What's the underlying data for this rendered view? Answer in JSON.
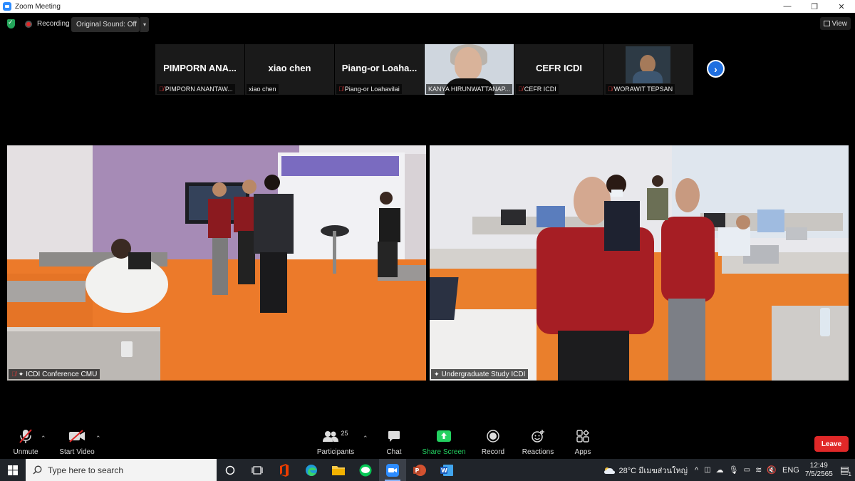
{
  "window": {
    "title": "Zoom Meeting"
  },
  "topbar": {
    "recording_label": "Recording",
    "original_sound_label": "Original Sound: Off",
    "view_label": "View"
  },
  "thumbnails": [
    {
      "display": "PIMPORN  ANA...",
      "label": "PIMPORN ANANTAW...",
      "muted": true,
      "video": false
    },
    {
      "display": "xiao chen",
      "label": "xiao chen",
      "muted": false,
      "video": false
    },
    {
      "display": "Piang-or  Loaha...",
      "label": "Piang-or Loahavilai",
      "muted": true,
      "video": false
    },
    {
      "display": "",
      "label": "KANYA HIRUNWATTANAP...",
      "muted": false,
      "video": true
    },
    {
      "display": "CEFR ICDI",
      "label": "CEFR ICDI",
      "muted": true,
      "video": false
    },
    {
      "display": "",
      "label": "WORAWIT TEPSAN",
      "muted": true,
      "video": true
    }
  ],
  "main_videos": [
    {
      "label": "ICDI Conference CMU"
    },
    {
      "label": "Undergraduate Study ICDI"
    }
  ],
  "toolbar": {
    "unmute": "Unmute",
    "start_video": "Start Video",
    "participants": "Participants",
    "participants_count": "25",
    "chat": "Chat",
    "share_screen": "Share Screen",
    "record": "Record",
    "reactions": "Reactions",
    "apps": "Apps",
    "leave": "Leave"
  },
  "colors": {
    "accent_green": "#23d160",
    "leave_red": "#e02828",
    "share_green": "#23d160"
  },
  "taskbar": {
    "search_placeholder": "Type here to search",
    "weather": "28°C  มีเมฆส่วนใหญ่",
    "language": "ENG",
    "time": "12:49",
    "date": "7/5/2565",
    "notification_count": "1"
  }
}
